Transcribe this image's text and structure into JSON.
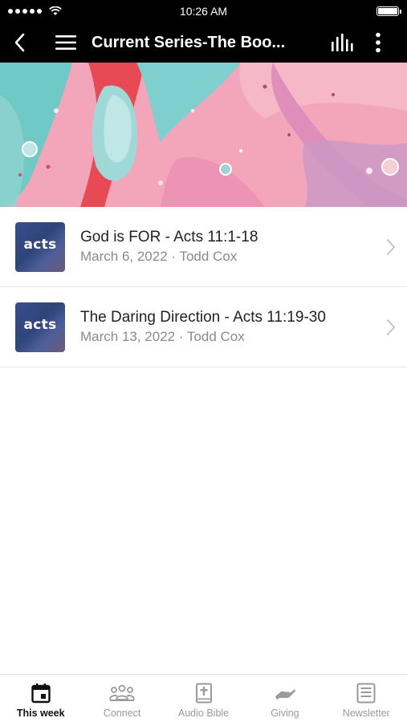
{
  "status_bar": {
    "time": "10:26 AM"
  },
  "nav": {
    "title": "Current Series-The Boo..."
  },
  "sermons": [
    {
      "thumbnail_text": "acts",
      "title": "God is FOR - Acts 11:1-18",
      "meta": "March 6, 2022 · Todd Cox"
    },
    {
      "thumbnail_text": "acts",
      "title": "The Daring Direction - Acts 11:19-30",
      "meta": "March 13, 2022 · Todd Cox"
    }
  ],
  "tabs": [
    {
      "label": "This week",
      "icon": "calendar-icon",
      "active": true
    },
    {
      "label": "Connect",
      "icon": "people-icon",
      "active": false
    },
    {
      "label": "Audio Bible",
      "icon": "bible-icon",
      "active": false
    },
    {
      "label": "Giving",
      "icon": "giving-hand-icon",
      "active": false
    },
    {
      "label": "Newsletter",
      "icon": "newsletter-icon",
      "active": false
    }
  ],
  "colors": {
    "nav_background": "#000000",
    "active_tab": "#111111",
    "inactive_tab": "#9a9a9a"
  }
}
